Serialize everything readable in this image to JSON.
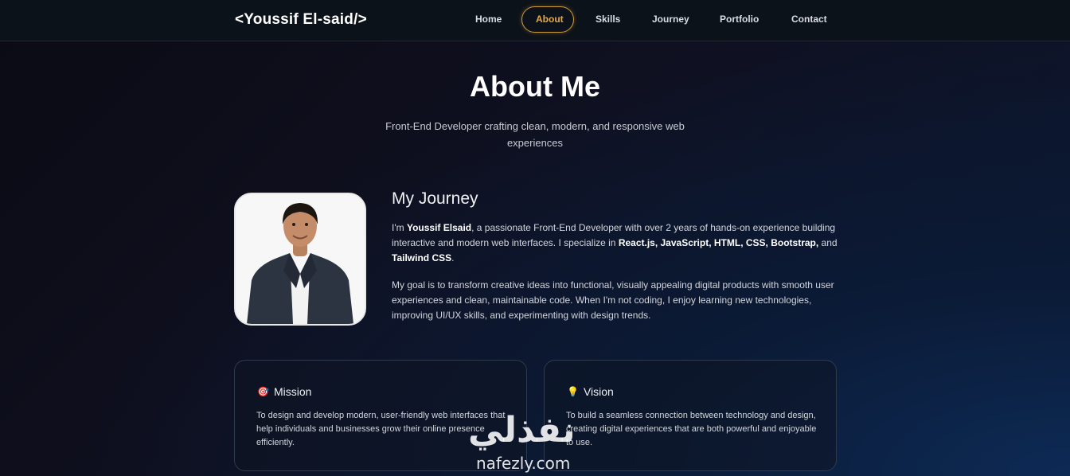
{
  "brand": "<Youssif El-said/>",
  "nav": {
    "items": [
      {
        "label": "Home",
        "active": false
      },
      {
        "label": "About",
        "active": true
      },
      {
        "label": "Skills",
        "active": false
      },
      {
        "label": "Journey",
        "active": false
      },
      {
        "label": "Portfolio",
        "active": false
      },
      {
        "label": "Contact",
        "active": false
      }
    ]
  },
  "about": {
    "title": "About Me",
    "subtitle": "Front-End Developer crafting clean, modern, and responsive web experiences"
  },
  "journey": {
    "title": "My Journey",
    "para1": {
      "t1": "I'm ",
      "name": "Youssif Elsaid",
      "t2": ", a passionate Front-End Developer with over 2 years of hands-on experience building interactive and modern web interfaces. I specialize in ",
      "skills": "React.js, JavaScript, HTML, CSS, Bootstrap,",
      "t3": " and ",
      "last": "Tailwind CSS",
      "t4": "."
    },
    "para2": "My goal is to transform creative ideas into functional, visually appealing digital products with smooth user experiences and clean, maintainable code. When I'm not coding, I enjoy learning new technologies, improving UI/UX skills, and experimenting with design trends."
  },
  "cards": [
    {
      "icon": "target-icon",
      "glyph": "🎯",
      "title": "Mission",
      "text": "To design and develop modern, user-friendly web interfaces that help individuals and businesses grow their online presence efficiently."
    },
    {
      "icon": "lightbulb-icon",
      "glyph": "💡",
      "title": "Vision",
      "text": "To build a seamless connection between technology and design, creating digital experiences that are both powerful and enjoyable to use."
    }
  ],
  "watermark": {
    "arabic": "نفذلي",
    "latin": "nafezly.com"
  },
  "colors": {
    "accent": "#d29b3a",
    "background": "#0c1219"
  }
}
